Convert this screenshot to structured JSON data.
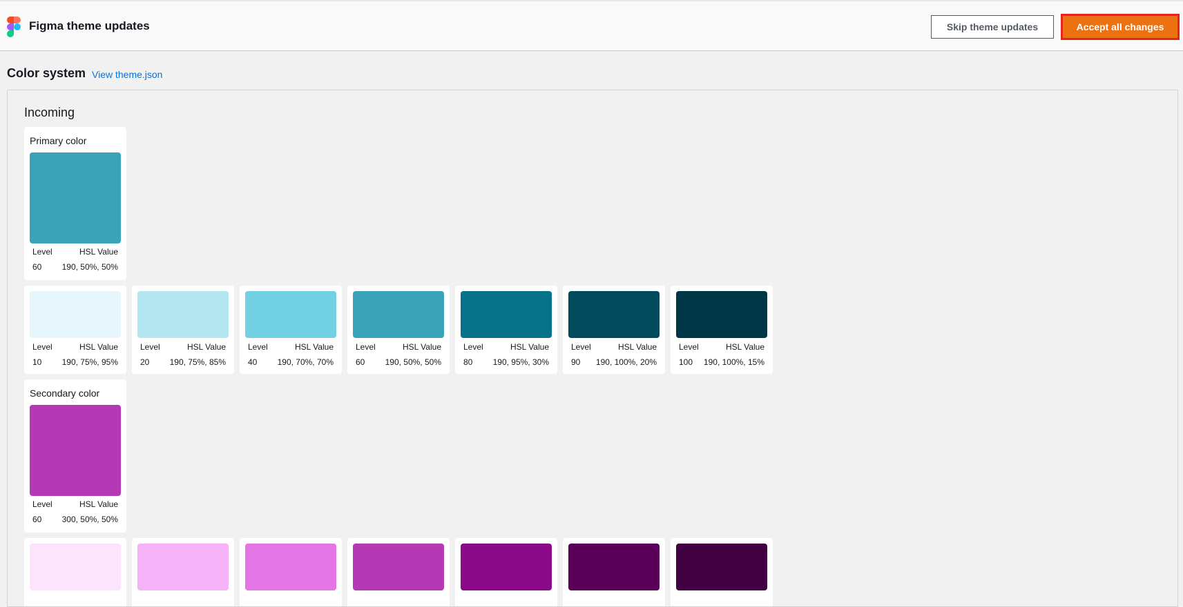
{
  "app": {
    "title": "Figma theme updates"
  },
  "actions": {
    "skip_label": "Skip theme updates",
    "accept_label": "Accept all changes"
  },
  "section": {
    "title": "Color system",
    "link_label": "View theme.json"
  },
  "incoming": {
    "title": "Incoming"
  },
  "labels": {
    "level": "Level",
    "hsl": "HSL Value"
  },
  "primary": {
    "label": "Primary color",
    "main": {
      "level": "60",
      "hsl": "190, 50%, 50%",
      "color": "#3aa3b8"
    },
    "scale": [
      {
        "level": "10",
        "hsl": "190, 75%, 95%",
        "color": "#e6f6fa"
      },
      {
        "level": "20",
        "hsl": "190, 75%, 85%",
        "color": "#b4e7f2"
      },
      {
        "level": "40",
        "hsl": "190, 70%, 70%",
        "color": "#73d1e4"
      },
      {
        "level": "60",
        "hsl": "190, 50%, 50%",
        "color": "#3aa3b8"
      },
      {
        "level": "80",
        "hsl": "190, 95%, 30%",
        "color": "#07728a"
      },
      {
        "level": "90",
        "hsl": "190, 100%, 20%",
        "color": "#004a5c"
      },
      {
        "level": "100",
        "hsl": "190, 100%, 15%",
        "color": "#003746"
      }
    ]
  },
  "secondary": {
    "label": "Secondary color",
    "main": {
      "level": "60",
      "hsl": "300, 50%, 50%",
      "color": "#b538b5"
    },
    "scale": [
      {
        "color": "#fde4fd"
      },
      {
        "color": "#f6b2f6"
      },
      {
        "color": "#e475e4"
      },
      {
        "color": "#b538b5"
      },
      {
        "color": "#8a0a8a"
      },
      {
        "color": "#5b0059"
      },
      {
        "color": "#410041"
      }
    ]
  }
}
